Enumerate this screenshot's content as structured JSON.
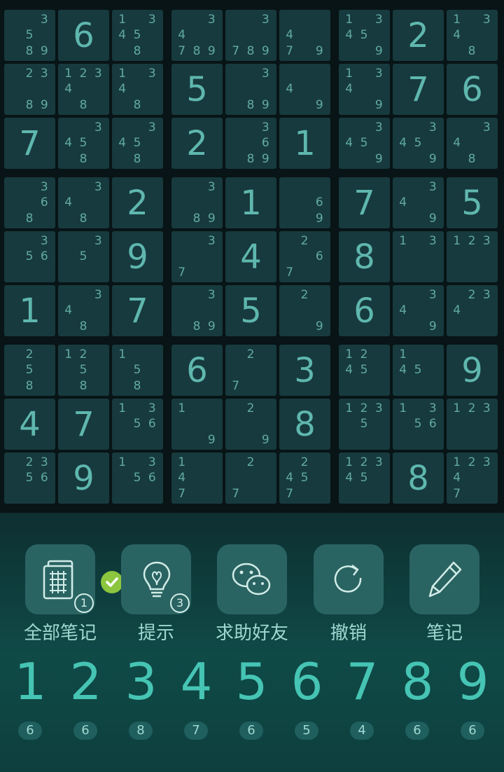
{
  "board": {
    "cells": [
      [
        {
          "n": [
            3,
            5,
            8,
            9
          ]
        },
        {
          "v": "6"
        },
        {
          "n": [
            1,
            3,
            4,
            5,
            8
          ]
        },
        {
          "n": [
            3,
            4,
            7,
            8,
            9
          ]
        },
        {
          "n": [
            3,
            7,
            8,
            9
          ]
        },
        {
          "n": [
            4,
            7,
            9
          ]
        },
        {
          "n": [
            1,
            3,
            4,
            5,
            9
          ]
        },
        {
          "v": "2"
        },
        {
          "n": [
            1,
            3,
            4,
            8
          ]
        }
      ],
      [
        {
          "n": [
            2,
            3,
            8,
            9
          ]
        },
        {
          "n": [
            1,
            2,
            3,
            4,
            8
          ]
        },
        {
          "n": [
            1,
            3,
            4,
            8
          ]
        },
        {
          "v": "5"
        },
        {
          "n": [
            3,
            8,
            9
          ]
        },
        {
          "n": [
            4,
            9
          ]
        },
        {
          "n": [
            1,
            3,
            4,
            9
          ]
        },
        {
          "v": "7"
        },
        {
          "v": "6"
        }
      ],
      [
        {
          "v": "7"
        },
        {
          "n": [
            3,
            4,
            5,
            8
          ]
        },
        {
          "n": [
            3,
            4,
            5,
            8
          ]
        },
        {
          "v": "2"
        },
        {
          "n": [
            3,
            6,
            8,
            9
          ]
        },
        {
          "v": "1"
        },
        {
          "n": [
            3,
            4,
            5,
            9
          ]
        },
        {
          "n": [
            3,
            4,
            5,
            9
          ]
        },
        {
          "n": [
            3,
            4,
            8
          ]
        }
      ],
      [
        {
          "n": [
            3,
            6,
            8
          ]
        },
        {
          "n": [
            3,
            4,
            8
          ]
        },
        {
          "v": "2"
        },
        {
          "n": [
            3,
            8,
            9
          ]
        },
        {
          "v": "1"
        },
        {
          "n": [
            6,
            9
          ]
        },
        {
          "v": "7"
        },
        {
          "n": [
            3,
            4,
            9
          ]
        },
        {
          "v": "5"
        }
      ],
      [
        {
          "n": [
            3,
            5,
            6
          ]
        },
        {
          "n": [
            3,
            5
          ]
        },
        {
          "v": "9"
        },
        {
          "n": [
            3,
            7
          ]
        },
        {
          "v": "4"
        },
        {
          "n": [
            2,
            6,
            7
          ]
        },
        {
          "v": "8"
        },
        {
          "n": [
            1,
            3
          ]
        },
        {
          "n": [
            1,
            2,
            3
          ]
        }
      ],
      [
        {
          "v": "1"
        },
        {
          "n": [
            3,
            4,
            8
          ]
        },
        {
          "v": "7"
        },
        {
          "n": [
            3,
            8,
            9
          ]
        },
        {
          "v": "5"
        },
        {
          "n": [
            2,
            9
          ]
        },
        {
          "v": "6"
        },
        {
          "n": [
            3,
            4,
            9
          ]
        },
        {
          "n": [
            2,
            3,
            4
          ]
        }
      ],
      [
        {
          "n": [
            2,
            5,
            8
          ]
        },
        {
          "n": [
            1,
            2,
            5,
            8
          ]
        },
        {
          "n": [
            1,
            5,
            8
          ]
        },
        {
          "v": "6"
        },
        {
          "n": [
            2,
            7
          ]
        },
        {
          "v": "3"
        },
        {
          "n": [
            1,
            2,
            4,
            5
          ]
        },
        {
          "n": [
            1,
            4,
            5
          ]
        },
        {
          "v": "9"
        }
      ],
      [
        {
          "v": "4"
        },
        {
          "v": "7"
        },
        {
          "n": [
            1,
            3,
            5,
            6
          ]
        },
        {
          "n": [
            1,
            9
          ]
        },
        {
          "n": [
            2,
            9
          ]
        },
        {
          "v": "8"
        },
        {
          "n": [
            1,
            2,
            3,
            5
          ]
        },
        {
          "n": [
            1,
            3,
            5,
            6
          ]
        },
        {
          "n": [
            1,
            2,
            3
          ]
        }
      ],
      [
        {
          "n": [
            2,
            3,
            5,
            6
          ]
        },
        {
          "v": "9"
        },
        {
          "n": [
            1,
            3,
            5,
            6
          ]
        },
        {
          "n": [
            1,
            4,
            7
          ]
        },
        {
          "n": [
            2,
            7
          ]
        },
        {
          "n": [
            2,
            4,
            5,
            7
          ]
        },
        {
          "n": [
            1,
            2,
            3,
            4,
            5
          ]
        },
        {
          "v": "8"
        },
        {
          "n": [
            1,
            2,
            3,
            4,
            7
          ]
        }
      ]
    ]
  },
  "tools": [
    {
      "name": "all-notes",
      "label": "全部笔记",
      "badge": "1",
      "icon": "notes-grid-icon",
      "checked": true
    },
    {
      "name": "hint",
      "label": "提示",
      "badge": "3",
      "icon": "lightbulb-icon"
    },
    {
      "name": "ask-friend",
      "label": "求助好友",
      "icon": "wechat-icon"
    },
    {
      "name": "undo",
      "label": "撤销",
      "icon": "undo-icon"
    },
    {
      "name": "notes",
      "label": "笔记",
      "icon": "pencil-icon"
    }
  ],
  "numpad": [
    {
      "digit": "1",
      "count": "6"
    },
    {
      "digit": "2",
      "count": "6"
    },
    {
      "digit": "3",
      "count": "8"
    },
    {
      "digit": "4",
      "count": "7"
    },
    {
      "digit": "5",
      "count": "6"
    },
    {
      "digit": "6",
      "count": "5"
    },
    {
      "digit": "7",
      "count": "4"
    },
    {
      "digit": "8",
      "count": "6"
    },
    {
      "digit": "9",
      "count": "6"
    }
  ],
  "colors": {
    "given": "#5fb7ae",
    "note": "#61aaa3",
    "numpad": "#46c4b4",
    "check": "#8cc63f",
    "cell": "#173a3e"
  }
}
